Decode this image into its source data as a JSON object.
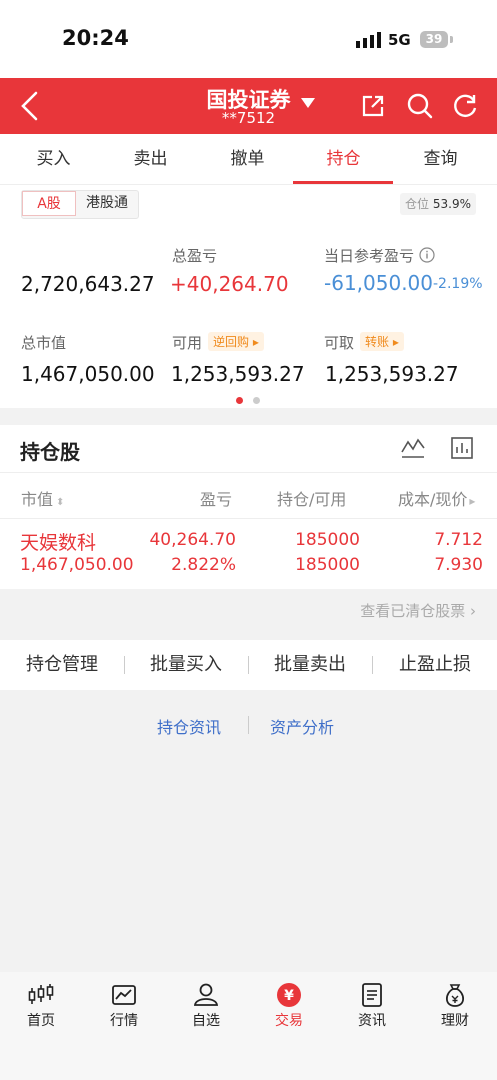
{
  "status_bar": {
    "time": "20:24",
    "network": "5G",
    "battery": "39"
  },
  "header": {
    "title": "国投证券",
    "account": "**7512"
  },
  "tabs": [
    "买入",
    "卖出",
    "撤单",
    "持仓",
    "查询"
  ],
  "market_tabs": {
    "a_share": "A股",
    "hk_connect": "港股通"
  },
  "position_badge": {
    "label": "仓位",
    "value": "53.9%"
  },
  "summary": {
    "total_assets": "2,720,643.27",
    "total_pl_label": "总盈亏",
    "total_pl": "+40,264.70",
    "daily_pl_label": "当日参考盈亏",
    "daily_pl": "-61,050.00",
    "daily_pl_pct": "-2.19%",
    "market_value_label": "总市值",
    "market_value": "1,467,050.00",
    "available_label": "可用",
    "available_chip": "逆回购",
    "available": "1,253,593.27",
    "withdrawable_label": "可取",
    "withdrawable_chip": "转账",
    "withdrawable": "1,253,593.27"
  },
  "holdings": {
    "title": "持仓股",
    "columns": {
      "market_value": "市值",
      "profit": "盈亏",
      "position": "持仓/可用",
      "cost": "成本/现价"
    },
    "rows": [
      {
        "name": "天娱数科",
        "market_value": "1,467,050.00",
        "profit": "40,264.70",
        "profit_pct": "2.822%",
        "position": "185000",
        "available": "185000",
        "cost": "7.712",
        "price": "7.930"
      }
    ],
    "cleared_link": "查看已清仓股票"
  },
  "actions": [
    "持仓管理",
    "批量买入",
    "批量卖出",
    "止盈止损"
  ],
  "links": {
    "info": "持仓资讯",
    "analysis": "资产分析"
  },
  "bottom_nav": [
    "首页",
    "行情",
    "自选",
    "交易",
    "资讯",
    "理财"
  ],
  "colors": {
    "brand_red": "#e8363a",
    "link_blue": "#3f6fc9",
    "loss_blue": "#4a8fd6",
    "chip_orange": "#f08a1c"
  }
}
